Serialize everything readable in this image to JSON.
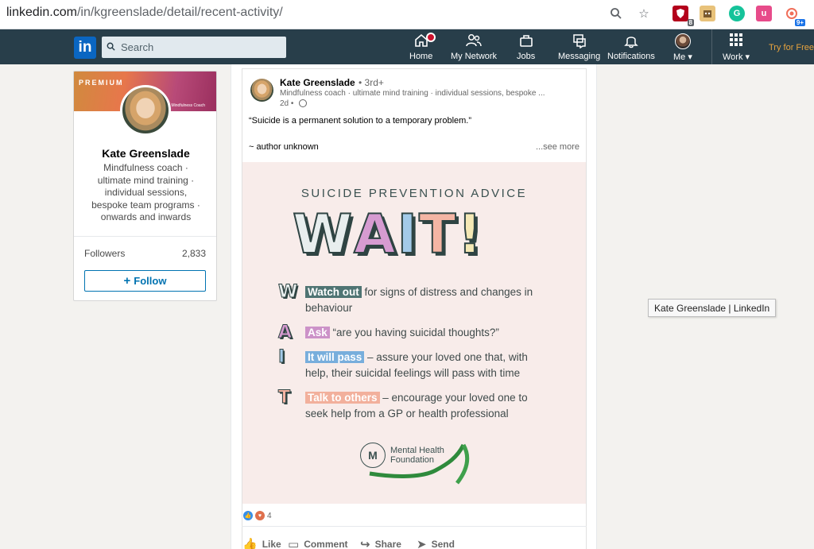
{
  "browser": {
    "url_host": "linkedin.com",
    "url_path": "/in/kgreenslade/detail/recent-activity/",
    "extensions": [
      {
        "name": "ublock-icon",
        "color": "#b3001b",
        "label": "",
        "badge": "8"
      },
      {
        "name": "robot-icon",
        "color": "#e8c27a",
        "label": "",
        "badge": ""
      },
      {
        "name": "grammarly-icon",
        "color": "#15c39a",
        "label": "G",
        "badge": ""
      },
      {
        "name": "u-icon",
        "color": "#e74b8a",
        "label": "u",
        "badge": ""
      },
      {
        "name": "todoist-icon",
        "color": "#f06f5a",
        "label": "",
        "badge": "9+"
      }
    ]
  },
  "nav": {
    "logo": "in",
    "search_placeholder": "Search",
    "items": [
      {
        "label": "Home",
        "icon": "home-icon"
      },
      {
        "label": "My Network",
        "icon": "network-icon"
      },
      {
        "label": "Jobs",
        "icon": "briefcase-icon"
      },
      {
        "label": "Messaging",
        "icon": "messaging-icon"
      },
      {
        "label": "Notifications",
        "icon": "bell-icon"
      },
      {
        "label": "Me",
        "icon": "avatar"
      },
      {
        "label": "Work",
        "icon": "grid-icon"
      }
    ],
    "try_free": "Try for Free"
  },
  "profile": {
    "badge": "PREMIUM",
    "banner_small": "Kate Greenslade | Mindfulness Coach",
    "name": "Kate Greenslade",
    "headline": "Mindfulness coach · ultimate mind training · individual sessions, bespoke team programs · onwards and inwards",
    "followers_label": "Followers",
    "followers_count": "2,833",
    "follow_button": "Follow"
  },
  "post": {
    "author": "Kate Greenslade",
    "degree": "• 3rd+",
    "headline": "Mindfulness coach · ultimate mind training · individual sessions, bespoke ...",
    "time": "2d •",
    "text": "“Suicide is a permanent solution to a temporary problem.”",
    "subtext": "~ author unknown",
    "see_more": "...see more",
    "image": {
      "title": "SUICIDE PREVENTION ADVICE",
      "letters": [
        "W",
        "A",
        "I",
        "T",
        "!"
      ],
      "tips": [
        {
          "letter": "W",
          "highlight": "Watch out",
          "rest": "for signs of distress and changes in behaviour"
        },
        {
          "letter": "A",
          "highlight": "Ask",
          "rest": "“are you having suicidal thoughts?”"
        },
        {
          "letter": "I",
          "highlight": "It will pass",
          "rest": "– assure your loved one that, with help, their suicidal feelings will pass with time"
        },
        {
          "letter": "T",
          "highlight": "Talk to others",
          "rest": "– encourage your loved one to seek help from a GP or health professional"
        }
      ],
      "logo_mark": "M",
      "logo_line1": "Mental Health",
      "logo_line2": "Foundation"
    },
    "reactions_count": "4",
    "actions": [
      "Like",
      "Comment",
      "Share",
      "Send"
    ]
  },
  "tooltip": "Kate Greenslade | LinkedIn"
}
